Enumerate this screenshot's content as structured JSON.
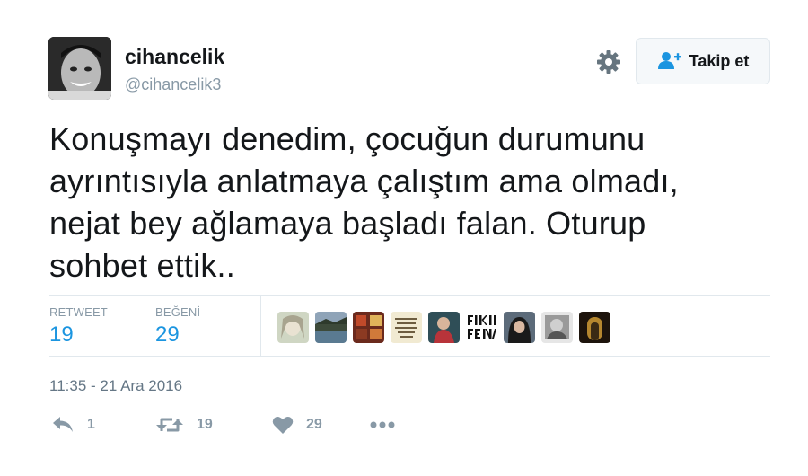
{
  "user": {
    "display_name": "cihancelik",
    "handle": "@cihancelik3"
  },
  "follow_button": {
    "label": "Takip et"
  },
  "tweet": {
    "lines": [
      "Konuşmayı denedim, çocuğun durumunu",
      "ayrıntısıyla anlatmaya çalıştım ama olmadı,",
      "nejat bey ağlamaya başladı falan. Oturup",
      "sohbet ettik.."
    ]
  },
  "stats": {
    "retweet_label": "RETWEET",
    "retweet_count": "19",
    "like_label": "BEĞENİ",
    "like_count": "29"
  },
  "timestamp": "11:35 - 21 Ara 2016",
  "actions": {
    "reply_count": "1",
    "retweet_count": "19",
    "like_count": "29"
  },
  "colors": {
    "accent": "#1b95e0",
    "muted": "#8899a6",
    "text": "#14171a",
    "border": "#e1e8ed"
  },
  "icons": [
    "gear-icon",
    "follow-user-icon",
    "reply-icon",
    "retweet-icon",
    "heart-icon",
    "more-icon"
  ]
}
